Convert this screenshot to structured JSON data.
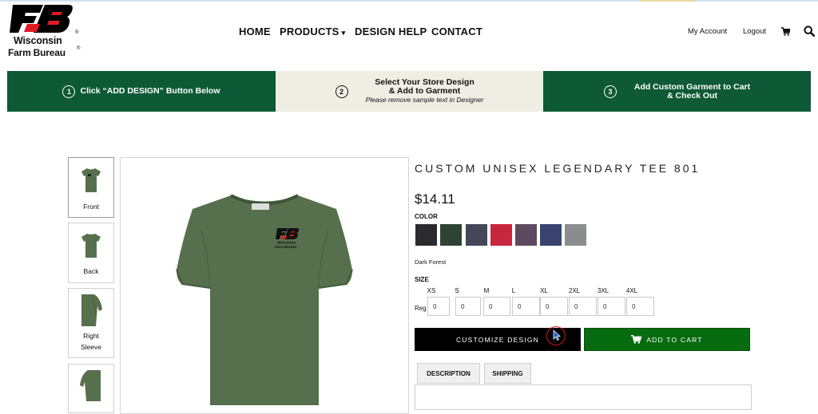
{
  "brand": {
    "line1": "Wisconsin",
    "line2": "Farm Bureau",
    "reg": "®"
  },
  "nav": {
    "home": "HOME",
    "products": "PRODUCTS",
    "design_help": "DESIGN HELP",
    "contact": "CONTACT",
    "caret": "▾"
  },
  "util": {
    "account": "My Account",
    "logout": "Logout"
  },
  "steps": [
    {
      "num": "1",
      "text": "Click “ADD DESIGN” Button Below"
    },
    {
      "num": "2",
      "text1": "Select Your Store Design",
      "text2": "& Add to Garment",
      "sub": "Please remove sample text in Designer"
    },
    {
      "num": "3",
      "text1": "Add Custom Garment to Cart",
      "text2": "& Check Out"
    }
  ],
  "thumbnails": [
    {
      "label1": "Front"
    },
    {
      "label1": "Back"
    },
    {
      "label1": "Right",
      "label2": "Sleeve"
    }
  ],
  "product": {
    "title": "CUSTOM UNISEX LEGENDARY TEE 801",
    "price": "$14.11",
    "color_label": "COLOR",
    "selected_color": "Dark Forest",
    "size_label": "SIZE",
    "sizes": [
      "XS",
      "S",
      "M",
      "L",
      "XL",
      "2XL",
      "3XL",
      "4XL"
    ],
    "row_label": "Reg",
    "qty_default": "0",
    "customize_label": "CUSTOMIZE DESIGN",
    "cart_label": "ADD TO CART",
    "tabs": [
      "DESCRIPTION",
      "SHIPPING"
    ]
  },
  "colors": {
    "banner_green": "#0e5a36",
    "banner_beige": "#f0ede4",
    "cart_green": "#076c10",
    "shirt": "#56704e",
    "swatches": [
      "#2b2b2d",
      "#2f4334",
      "#434757",
      "#c7263f",
      "#5d4a5f",
      "#3a4370",
      "#8b8c8e"
    ]
  }
}
